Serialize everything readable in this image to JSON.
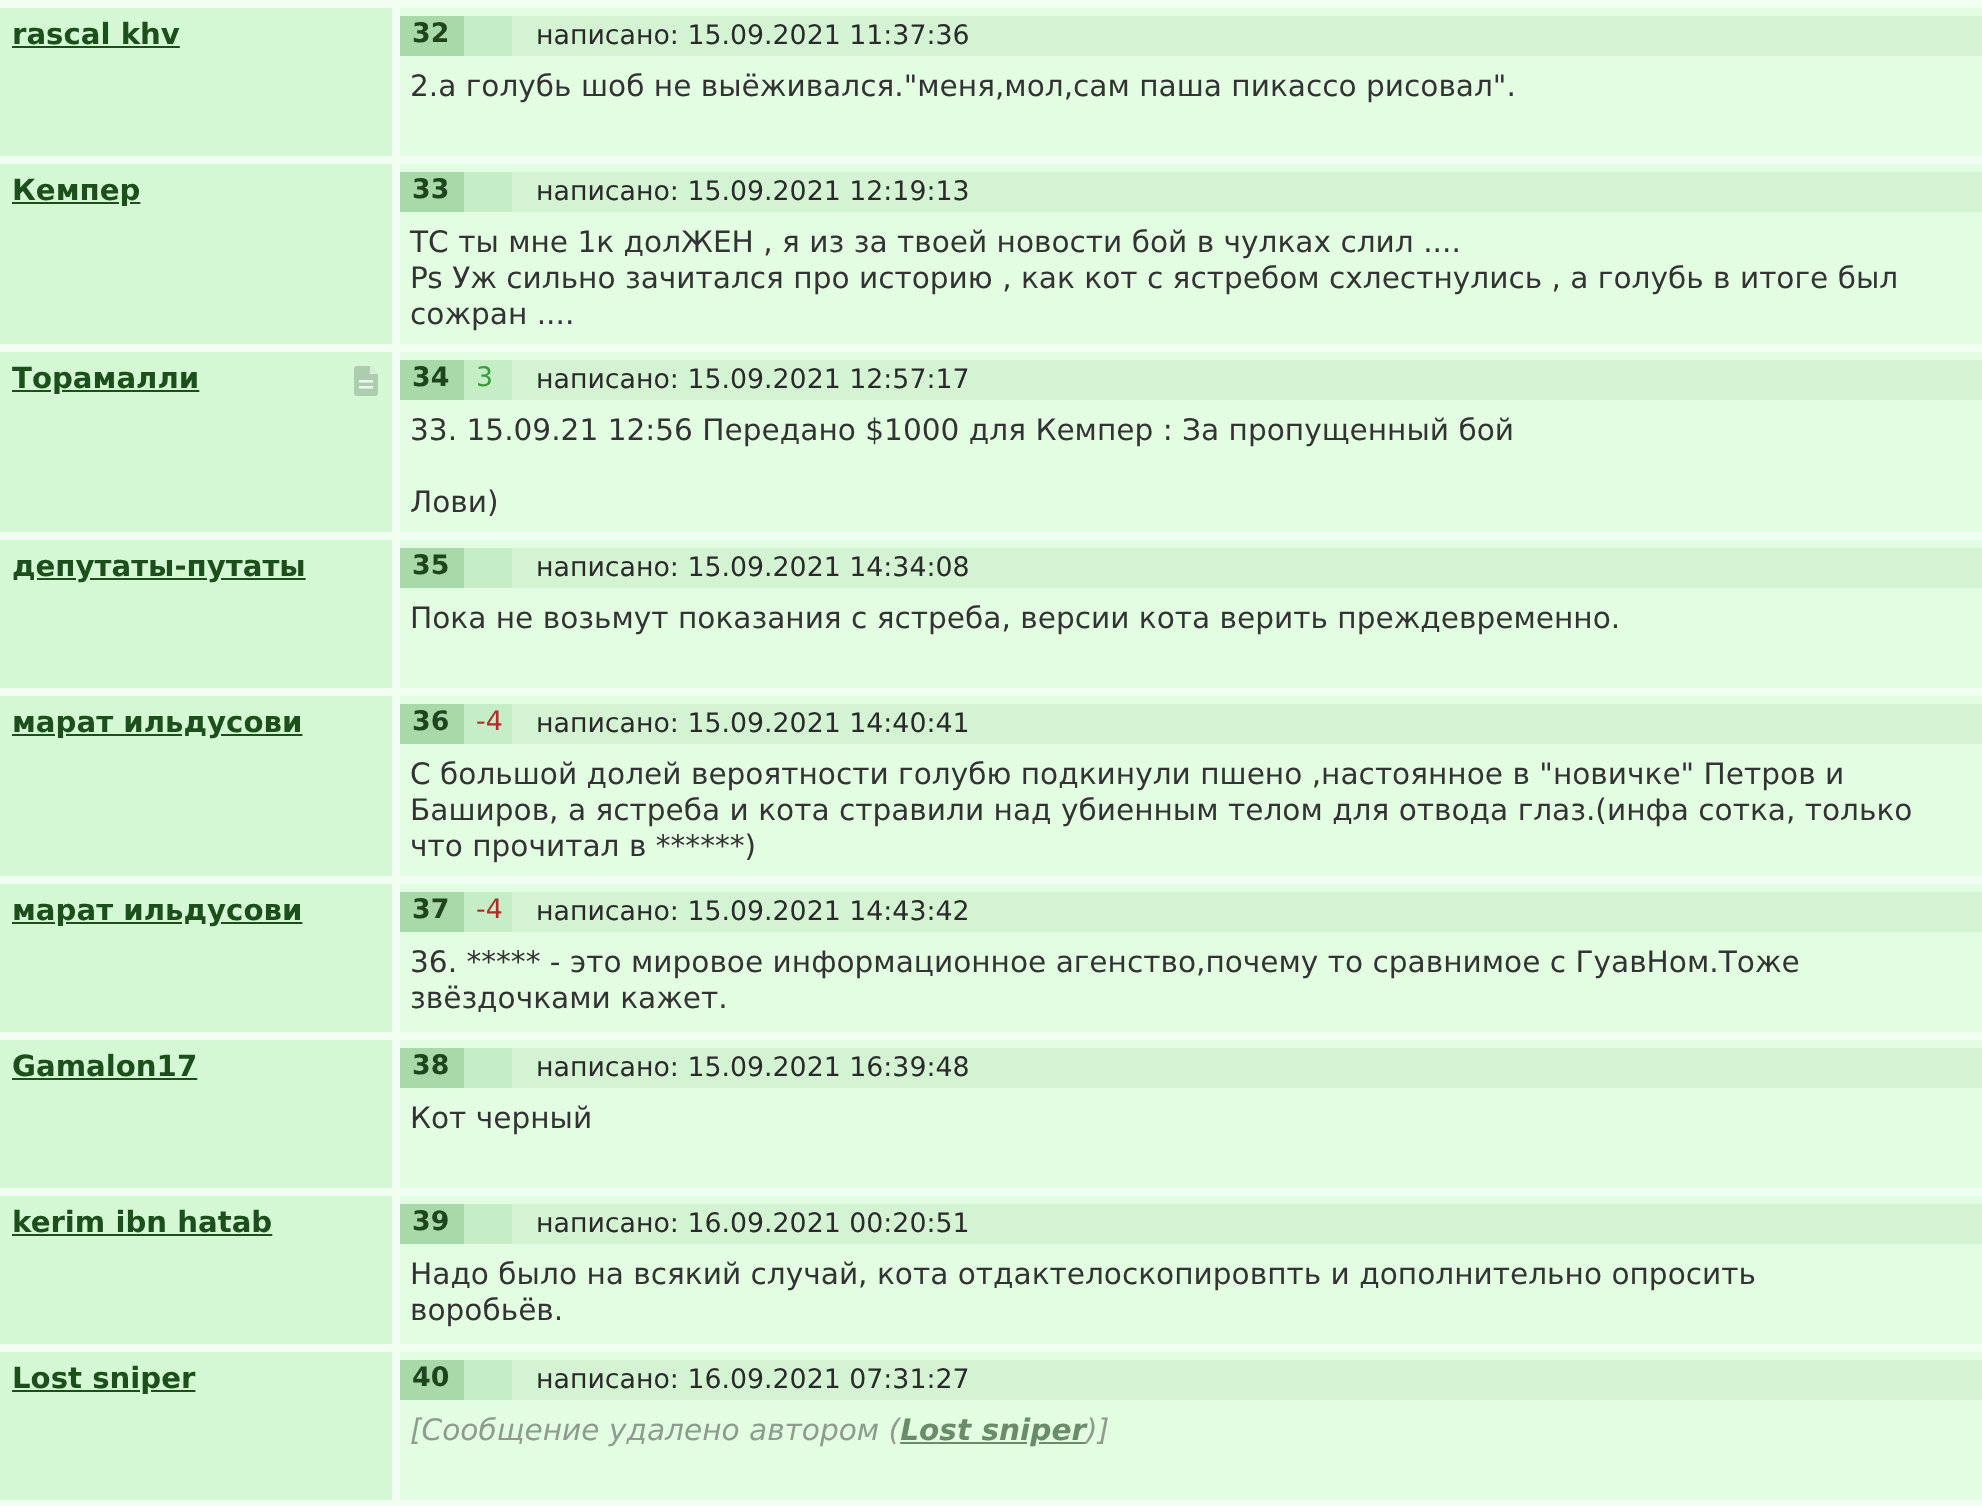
{
  "posts": [
    {
      "author": "rascal khv",
      "note_icon": false,
      "number": "32",
      "posted": "написано: 15.09.2021 11:37:36",
      "body": {
        "kind": "text",
        "text": "2.а голубь шоб не выёживался.\"меня,мол,сам паша пикассо рисовал\"."
      }
    },
    {
      "author": "Кемпер",
      "note_icon": false,
      "number": "33",
      "posted": "написано: 15.09.2021 12:19:13",
      "body": {
        "kind": "text",
        "text": "ТС ты мне 1к долЖЕН , я из за твоей новости бой в чулках слил ....\nPs Уж сильно зачитался про историю , как кот с ястребом схлестнулись , а голубь в итоге был сожран ...."
      }
    },
    {
      "author": "Торамалли",
      "note_icon": true,
      "number": "34",
      "rating": {
        "text": "3",
        "kind": "positive"
      },
      "posted": "написано: 15.09.2021 12:57:17",
      "body": {
        "kind": "text",
        "text": "33. 15.09.21 12:56 Передано $1000 для Кемпер : За пропущенный бой\n\nЛови)"
      }
    },
    {
      "author": "депутаты-путаты",
      "note_icon": false,
      "number": "35",
      "posted": "написано: 15.09.2021 14:34:08",
      "body": {
        "kind": "text",
        "text": "Пока не возьмут показания с ястреба, версии кота верить преждевременно."
      }
    },
    {
      "author": "марат ильдусови",
      "note_icon": false,
      "number": "36",
      "rating": {
        "text": "-4",
        "kind": "negative"
      },
      "posted": "написано: 15.09.2021 14:40:41",
      "body": {
        "kind": "text",
        "text": "С большой долей вероятности голубю подкинули пшено ,настоянное в \"новичке\" Петров и Баширов, а ястреба и кота стравили над убиенным телом для отвода глаз.(инфа сотка, только что прочитал в ******)"
      }
    },
    {
      "author": "марат ильдусови",
      "note_icon": false,
      "number": "37",
      "rating": {
        "text": "-4",
        "kind": "negative"
      },
      "posted": "написано: 15.09.2021 14:43:42",
      "body": {
        "kind": "text",
        "text": "36. ***** - это мировое информационное агенство,почему то сравнимое с ГуавНом.Тоже звёздочками кажет."
      }
    },
    {
      "author": "Gamalon17",
      "note_icon": false,
      "number": "38",
      "posted": "написано: 15.09.2021 16:39:48",
      "body": {
        "kind": "text",
        "text": "Кот черный"
      }
    },
    {
      "author": "kerim ibn hatab",
      "note_icon": false,
      "number": "39",
      "posted": "написано: 16.09.2021 00:20:51",
      "body": {
        "kind": "text",
        "text": "Надо было на всякий случай, кота отдактелоскопировпть и дополнительно опросить воробьёв."
      }
    },
    {
      "author": "Lost sniper",
      "note_icon": false,
      "number": "40",
      "posted": "написано: 16.09.2021 07:31:27",
      "body": {
        "kind": "deleted",
        "before": "[Сообщение удалено автором (",
        "link": "Lost sniper",
        "after": ")]"
      }
    }
  ]
}
